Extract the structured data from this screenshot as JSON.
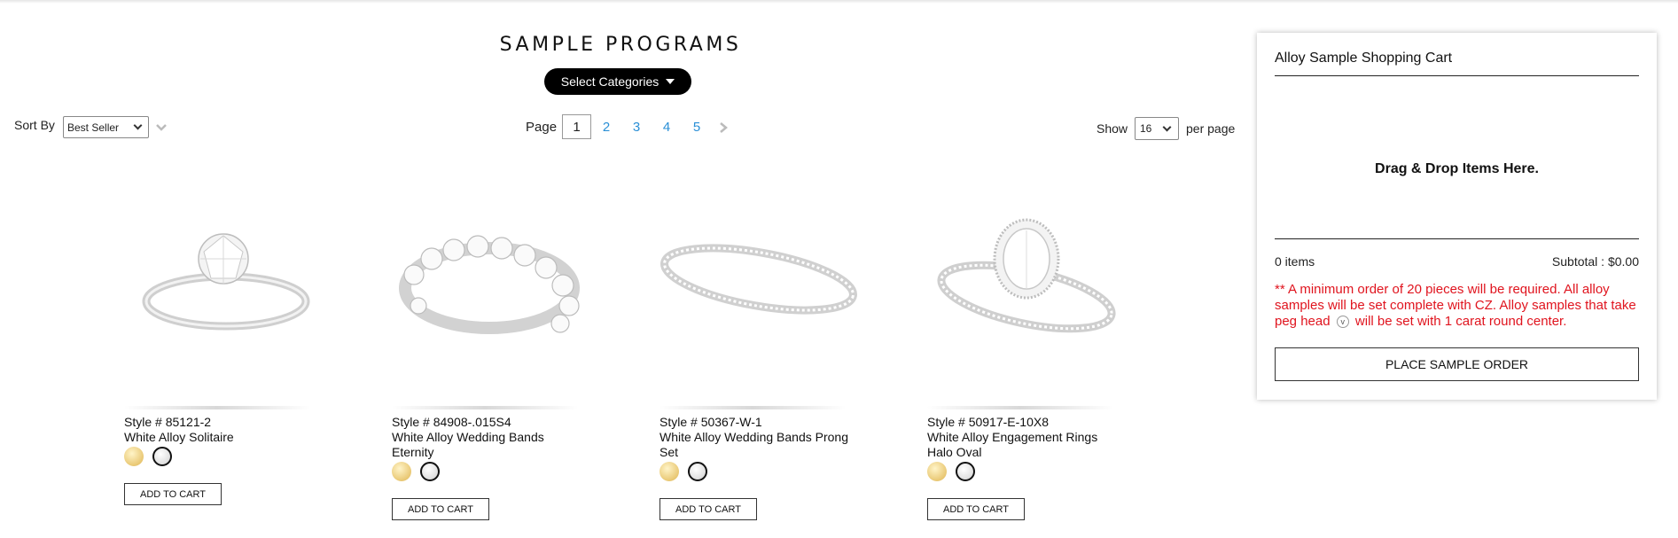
{
  "header": {
    "title": "SAMPLE PROGRAMS",
    "categories_button": "Select Categories"
  },
  "toolbar": {
    "sort_label": "Sort By",
    "sort_value": "Best Seller",
    "page_label": "Page",
    "pages": [
      "1",
      "2",
      "3",
      "4",
      "5"
    ],
    "current_page": "1",
    "show_label": "Show",
    "show_value": "16",
    "per_page_label": "per page"
  },
  "products": [
    {
      "style": "Style # 85121-2",
      "name": "White Alloy Solitaire",
      "button": "ADD TO CART",
      "image_icon": "solitaire-ring-image"
    },
    {
      "style": "Style # 84908-.015S4",
      "name": "White Alloy Wedding Bands Eternity",
      "button": "ADD TO CART",
      "image_icon": "eternity-band-image"
    },
    {
      "style": "Style # 50367-W-1",
      "name": "White Alloy Wedding Bands Prong Set",
      "button": "ADD TO CART",
      "image_icon": "prong-band-image"
    },
    {
      "style": "Style # 50917-E-10X8",
      "name": "White Alloy Engagement Rings Halo Oval",
      "button": "ADD TO CART",
      "image_icon": "halo-oval-ring-image"
    }
  ],
  "swatch_colors": {
    "gold": "#e9c874",
    "white": "#e2e2e2"
  },
  "cart": {
    "title": "Alloy Sample Shopping Cart",
    "drop_text": "Drag & Drop Items Here.",
    "items": "0 items",
    "subtotal": "Subtotal : $0.00",
    "note_part1": "** A minimum order of 20 pieces will be required. All alloy samples will be set complete with CZ. Alloy samples that take peg head",
    "note_icon": "v",
    "note_part2": "will be set with 1 carat round center.",
    "place_button": "PLACE SAMPLE ORDER"
  },
  "colors": {
    "accent_link": "#2a8fd6",
    "note_red": "#e0141e",
    "button_black": "#000000"
  }
}
